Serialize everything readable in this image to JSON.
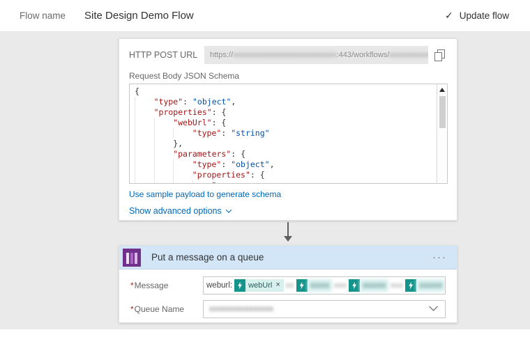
{
  "header": {
    "flow_name_label": "Flow name",
    "flow_title": "Site Design Demo Flow",
    "update_button": {
      "icon": "✓",
      "label": "Update flow"
    }
  },
  "http_card": {
    "post_url_label": "HTTP POST URL",
    "url_segments": [
      {
        "text": "https://",
        "redacted": false
      },
      {
        "text": "xxxxxxxxxxxxxxxxxxxxxxxxxxx",
        "redacted": true
      },
      {
        "text": ":443/workflows/",
        "redacted": false
      },
      {
        "text": "xxxxxxxxxxxx",
        "redacted": true
      }
    ],
    "schema_label": "Request Body JSON Schema",
    "code_lines": [
      "{",
      "    \"type\": \"object\",",
      "    \"properties\": {",
      "        \"webUrl\": {",
      "            \"type\": \"string\"",
      "        },",
      "        \"parameters\": {",
      "            \"type\": \"object\",",
      "            \"properties\": {",
      "                \""
    ],
    "sample_link": "Use sample payload to generate schema",
    "advanced_label": "Show advanced options"
  },
  "queue_card": {
    "title": "Put a message on a queue",
    "menu_icon": "···",
    "required_marker": "*",
    "message_label": "Message",
    "queue_label": "Queue Name",
    "message_segments": [
      {
        "type": "text",
        "text": "weburl:"
      },
      {
        "type": "token",
        "label": "webUrl",
        "close": "×"
      },
      {
        "type": "blurtext",
        "text": "xx"
      },
      {
        "type": "blurtoken",
        "text": "xxxxx"
      },
      {
        "type": "blurtext",
        "text": "xxx"
      },
      {
        "type": "blurtoken",
        "text": "xxxxxx"
      },
      {
        "type": "blurtext",
        "text": "xxx"
      },
      {
        "type": "blurtoken",
        "text": "xxxxxx"
      }
    ],
    "queue_value_redacted": "xxxxxxxxxxxxxxxx"
  },
  "colors": {
    "link": "#0067b8",
    "required": "#a4262c",
    "token": "#16948c",
    "token_bg": "#d7f0ee",
    "header_bg": "#d2e6f7",
    "icon_purple": "#71308a",
    "json_key": "#a31515",
    "json_str": "#0451a5"
  }
}
